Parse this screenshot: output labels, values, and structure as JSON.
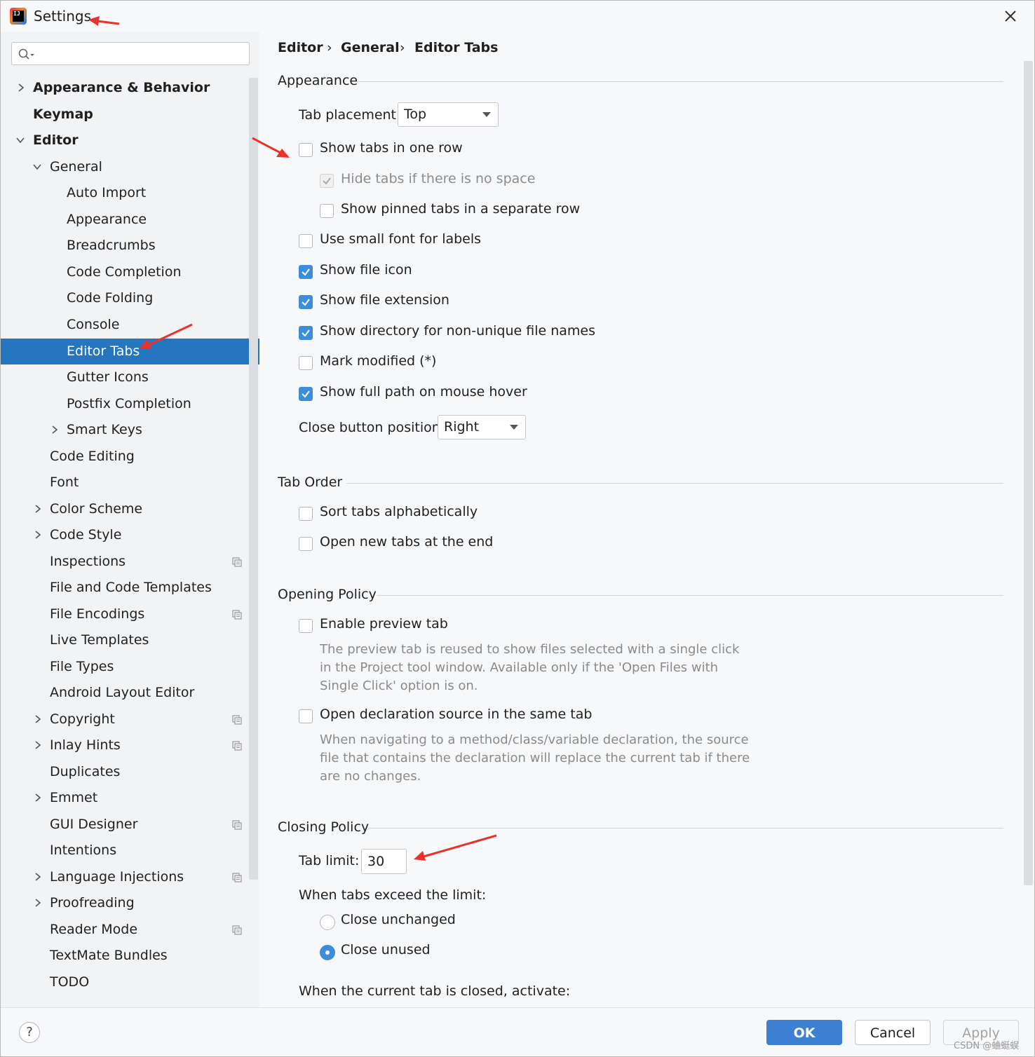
{
  "window": {
    "title": "Settings"
  },
  "search": {
    "placeholder": ""
  },
  "sidebar": {
    "items": [
      {
        "label": "Appearance & Behavior"
      },
      {
        "label": "Keymap"
      },
      {
        "label": "Editor"
      },
      {
        "label": "General"
      },
      {
        "label": "Auto Import"
      },
      {
        "label": "Appearance"
      },
      {
        "label": "Breadcrumbs"
      },
      {
        "label": "Code Completion"
      },
      {
        "label": "Code Folding"
      },
      {
        "label": "Console"
      },
      {
        "label": "Editor Tabs"
      },
      {
        "label": "Gutter Icons"
      },
      {
        "label": "Postfix Completion"
      },
      {
        "label": "Smart Keys"
      },
      {
        "label": "Code Editing"
      },
      {
        "label": "Font"
      },
      {
        "label": "Color Scheme"
      },
      {
        "label": "Code Style"
      },
      {
        "label": "Inspections"
      },
      {
        "label": "File and Code Templates"
      },
      {
        "label": "File Encodings"
      },
      {
        "label": "Live Templates"
      },
      {
        "label": "File Types"
      },
      {
        "label": "Android Layout Editor"
      },
      {
        "label": "Copyright"
      },
      {
        "label": "Inlay Hints"
      },
      {
        "label": "Duplicates"
      },
      {
        "label": "Emmet"
      },
      {
        "label": "GUI Designer"
      },
      {
        "label": "Intentions"
      },
      {
        "label": "Language Injections"
      },
      {
        "label": "Proofreading"
      },
      {
        "label": "Reader Mode"
      },
      {
        "label": "TextMate Bundles"
      },
      {
        "label": "TODO"
      }
    ],
    "selected": "Editor Tabs"
  },
  "breadcrumb": {
    "items": [
      "Editor",
      "General",
      "Editor Tabs"
    ],
    "separator": "›"
  },
  "appearance": {
    "title": "Appearance",
    "tab_placement_label": "Tab placement:",
    "tab_placement_value": "Top",
    "options": [
      {
        "label": "Show tabs in one row",
        "checked": false
      },
      {
        "label": "Hide tabs if there is no space",
        "checked": true,
        "disabled": true
      },
      {
        "label": "Show pinned tabs in a separate row",
        "checked": false
      },
      {
        "label": "Use small font for labels",
        "checked": false
      },
      {
        "label": "Show file icon",
        "checked": true
      },
      {
        "label": "Show file extension",
        "checked": true
      },
      {
        "label": "Show directory for non-unique file names",
        "checked": true
      },
      {
        "label": "Mark modified (*)",
        "checked": false
      },
      {
        "label": "Show full path on mouse hover",
        "checked": true
      }
    ],
    "close_button_label": "Close button position:",
    "close_button_value": "Right"
  },
  "tab_order": {
    "title": "Tab Order",
    "options": [
      {
        "label": "Sort tabs alphabetically",
        "checked": false
      },
      {
        "label": "Open new tabs at the end",
        "checked": false
      }
    ]
  },
  "opening_policy": {
    "title": "Opening Policy",
    "preview_label": "Enable preview tab",
    "preview_checked": false,
    "preview_desc": [
      "The preview tab is reused to show files selected with a single click",
      "in the Project tool window. Available only if the 'Open Files with",
      "Single Click' option is on."
    ],
    "declaration_label": "Open declaration source in the same tab",
    "declaration_checked": false,
    "declaration_desc": [
      "When navigating to a method/class/variable declaration, the source",
      "file that contains the declaration will replace the current tab if there",
      "are no changes."
    ]
  },
  "closing_policy": {
    "title": "Closing Policy",
    "tab_limit_label": "Tab limit:",
    "tab_limit_value": "30",
    "exceed_label": "When tabs exceed the limit:",
    "radio_options": [
      {
        "label": "Close unchanged",
        "checked": false
      },
      {
        "label": "Close unused",
        "checked": true
      }
    ],
    "activate_label": "When the current tab is closed, activate:"
  },
  "footer": {
    "ok": "OK",
    "cancel": "Cancel",
    "apply": "Apply",
    "help": "?"
  },
  "watermark": "CSDN @蛐蜓蜈",
  "colors": {
    "accent": "#2675bf",
    "check": "#3d8eda",
    "annotation": "#e8322a"
  }
}
